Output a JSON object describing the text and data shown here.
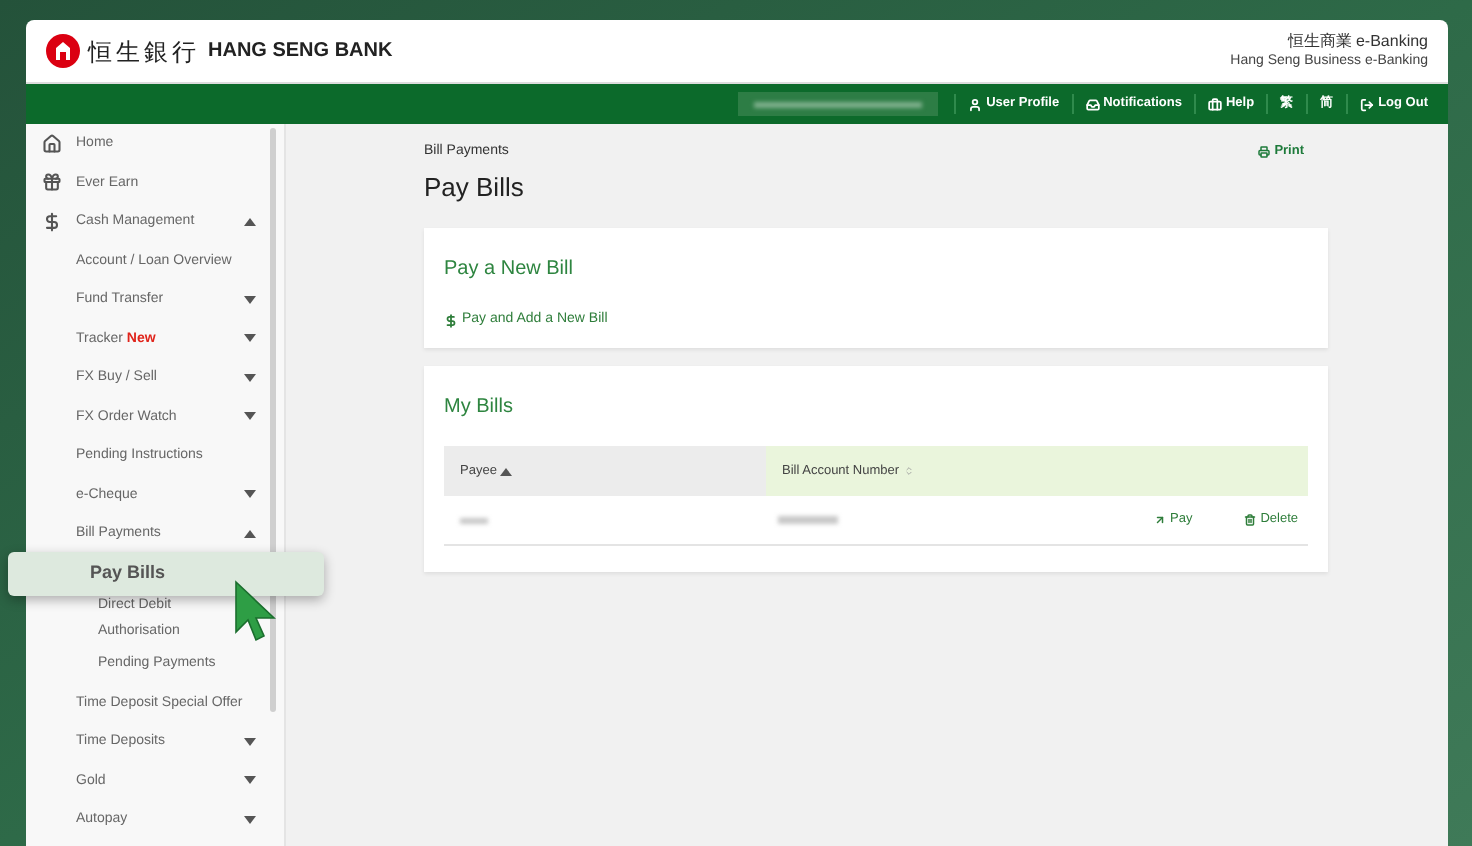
{
  "header": {
    "logo_chinese": "恒生銀行",
    "logo_english": "HANG SENG BANK",
    "product_chinese": "恒生商業 e-Banking",
    "product_english": "Hang Seng Business e-Banking"
  },
  "nav": {
    "links": [
      {
        "label": "User Profile"
      },
      {
        "label": "Notifications"
      },
      {
        "label": "Help"
      },
      {
        "label": "繁"
      },
      {
        "label": "简"
      },
      {
        "label": "Log Out"
      }
    ]
  },
  "sidebar": {
    "items": [
      {
        "label": "Home",
        "selected": false
      },
      {
        "label": "Ever Earn",
        "selected": false
      },
      {
        "label": "Cash Management",
        "selected": false,
        "expanded": true,
        "children": [
          {
            "label": "Account / Loan Overview",
            "selected": false
          },
          {
            "label": "Fund Transfer",
            "selected": false,
            "expanded": false
          },
          {
            "label": "Tracker",
            "badge": "New",
            "selected": false,
            "expanded": false
          },
          {
            "label": "FX Buy / Sell",
            "selected": false,
            "expanded": false
          },
          {
            "label": "FX Order Watch",
            "selected": false,
            "expanded": false
          },
          {
            "label": "Pending Instructions",
            "selected": false
          },
          {
            "label": "e-Cheque",
            "selected": false,
            "expanded": false
          },
          {
            "label": "Bill Payments",
            "selected": false,
            "expanded": true,
            "children": [
              {
                "label": "Pay Bills",
                "selected": true
              },
              {
                "label": "Direct Debit Authorisation",
                "selected": false
              },
              {
                "label": "Pending Payments",
                "selected": false
              }
            ]
          },
          {
            "label": "Time Deposit Special Offer",
            "selected": false
          },
          {
            "label": "Time Deposits",
            "selected": false,
            "expanded": false
          },
          {
            "label": "Gold",
            "selected": false,
            "expanded": false
          },
          {
            "label": "Autopay",
            "selected": false,
            "expanded": false
          }
        ]
      }
    ]
  },
  "main": {
    "breadcrumb": "Bill Payments",
    "title": "Pay Bills",
    "print": "Print",
    "pay_new_bill": {
      "title": "Pay a New Bill",
      "link": "Pay and Add a New Bill"
    },
    "my_bills": {
      "title": "My Bills",
      "columns": [
        {
          "label": "Payee",
          "sorted": true
        },
        {
          "label": "Bill Account Number",
          "sorted": false
        }
      ],
      "rows": [
        {
          "actions": [
            "Pay",
            "Delete"
          ]
        }
      ]
    }
  }
}
